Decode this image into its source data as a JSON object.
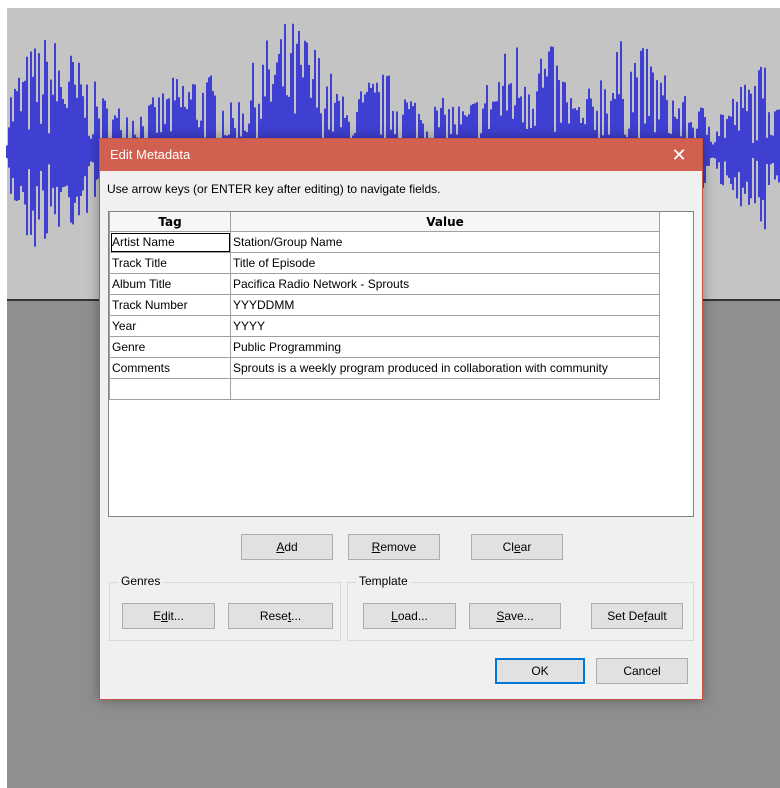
{
  "dialog": {
    "title": "Edit Metadata",
    "close_glyph": "✕",
    "instructions": "Use arrow keys (or ENTER key after editing) to navigate fields.",
    "columns": {
      "tag": "Tag",
      "value": "Value"
    },
    "rows": [
      {
        "tag": "Artist Name",
        "value": "Station/Group Name"
      },
      {
        "tag": "Track Title",
        "value": "Title of Episode"
      },
      {
        "tag": "Album Title",
        "value": "Pacifica Radio Network - Sprouts"
      },
      {
        "tag": "Track Number",
        "value": "YYYDDMM"
      },
      {
        "tag": "Year",
        "value": "YYYY"
      },
      {
        "tag": "Genre",
        "value": "Public Programming"
      },
      {
        "tag": "Comments",
        "value": "Sprouts is a weekly program produced in collaboration with community"
      },
      {
        "tag": "",
        "value": ""
      }
    ],
    "buttons": {
      "add": {
        "pre": "",
        "key": "A",
        "post": "dd"
      },
      "remove": {
        "pre": "",
        "key": "R",
        "post": "emove"
      },
      "clear": {
        "pre": "Cl",
        "key": "e",
        "post": "ar"
      }
    },
    "genres": {
      "label": "Genres",
      "edit": {
        "pre": "E",
        "key": "d",
        "post": "it..."
      },
      "reset": {
        "pre": "Rese",
        "key": "t",
        "post": "..."
      }
    },
    "template": {
      "label": "Template",
      "load": {
        "pre": "",
        "key": "L",
        "post": "oad..."
      },
      "save": {
        "pre": "",
        "key": "S",
        "post": "ave..."
      },
      "set_default": {
        "pre": "Set De",
        "key": "f",
        "post": "ault"
      }
    },
    "ok_label": "OK",
    "cancel_label": "Cancel"
  },
  "colors": {
    "title_bar": "#d16050",
    "waveform": "#3f3fd2",
    "track_background": "#c4c4c4",
    "canvas": "#8f8f8f",
    "default_button_border": "#0078d7"
  }
}
